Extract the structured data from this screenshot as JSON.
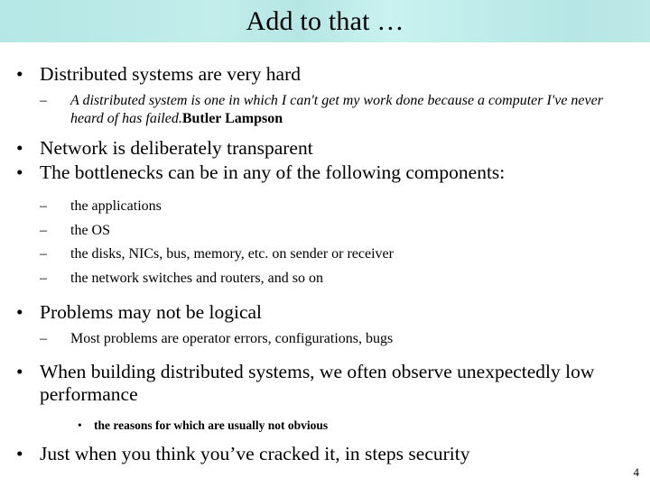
{
  "slide": {
    "title": "Add to that …",
    "page_number": "4",
    "colors": {
      "banner_left": "#b4e7e5",
      "banner_mid": "#c9f2f0",
      "banner_right": "#bde9e8",
      "text": "#000000",
      "background": "#ffffff"
    },
    "markers": {
      "level1": "•",
      "level2": "–",
      "level3": "•"
    },
    "content": {
      "hard": "Distributed systems are very hard",
      "quote_text": "A distributed system is one in which I can't get my work done because a computer I've never heard of has failed.",
      "quote_attribution": "Butler Lampson",
      "network": "Network is deliberately transparent",
      "bottlenecks": "The bottlenecks can be in any of the following components:",
      "components": [
        "the applications",
        "the OS",
        "the disks, NICs, bus, memory, etc. on sender or receiver",
        "the network switches and routers, and so on"
      ],
      "logical": "Problems may not be logical",
      "most_problems": "Most problems are operator errors, configurations, bugs",
      "building": "When building distributed systems, we often observe unexpectedly low performance",
      "reasons": "the reasons for which are usually not obvious",
      "security": "Just when you think you’ve cracked it, in steps security"
    }
  }
}
